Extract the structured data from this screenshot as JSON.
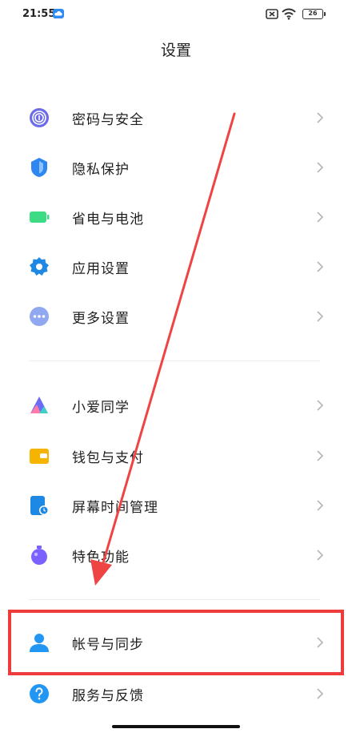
{
  "status": {
    "time": "21:55",
    "battery": "26"
  },
  "title": "设置",
  "groups": [
    {
      "items": [
        {
          "label": "密码与安全",
          "icon": "fingerprint-icon",
          "color": "#6c6ce8"
        },
        {
          "label": "隐私保护",
          "icon": "privacy-shield-icon",
          "color": "#2e86f0"
        },
        {
          "label": "省电与电池",
          "icon": "battery-icon",
          "color": "#3ddc84"
        },
        {
          "label": "应用设置",
          "icon": "gear-icon",
          "color": "#1e88e5"
        },
        {
          "label": "更多设置",
          "icon": "more-dots-icon",
          "color": "#8fa8f0"
        }
      ]
    },
    {
      "items": [
        {
          "label": "小爱同学",
          "icon": "xiaoai-icon",
          "color": "#6b6bf5"
        },
        {
          "label": "钱包与支付",
          "icon": "wallet-icon",
          "color": "#f5b400"
        },
        {
          "label": "屏幕时间管理",
          "icon": "screen-time-icon",
          "color": "#1e88e5"
        },
        {
          "label": "特色功能",
          "icon": "feature-icon",
          "color": "#7b61ff"
        }
      ]
    },
    {
      "items": [
        {
          "label": "帐号与同步",
          "icon": "account-icon",
          "color": "#2196f3"
        },
        {
          "label": "服务与反馈",
          "icon": "help-icon",
          "color": "#2196f3"
        }
      ]
    }
  ],
  "annotation_color": "#ee3b3b"
}
